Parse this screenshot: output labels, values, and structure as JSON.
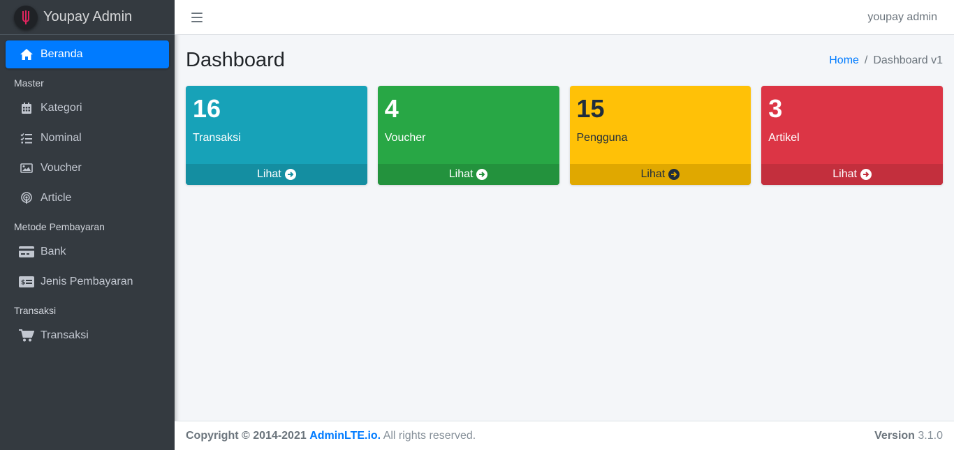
{
  "brand": {
    "name": "Youpay Admin"
  },
  "sidebar": {
    "items": [
      {
        "label": "Beranda",
        "icon": "home-icon"
      },
      {
        "header": "Master"
      },
      {
        "label": "Kategori",
        "icon": "calendar-icon"
      },
      {
        "label": "Nominal",
        "icon": "tasks-icon"
      },
      {
        "label": "Voucher",
        "icon": "image-icon"
      },
      {
        "label": "Article",
        "icon": "podcast-icon"
      },
      {
        "header": "Metode Pembayaran"
      },
      {
        "label": "Bank",
        "icon": "credit-card-icon"
      },
      {
        "label": "Jenis Pembayaran",
        "icon": "money-check-icon"
      },
      {
        "header": "Transaksi"
      },
      {
        "label": "Transaksi",
        "icon": "cart-icon"
      }
    ]
  },
  "topbar": {
    "user": "youpay admin"
  },
  "header": {
    "title": "Dashboard",
    "breadcrumb": [
      "Home",
      "Dashboard v1"
    ],
    "breadcrumb_sep": "/"
  },
  "boxes": [
    {
      "count": "16",
      "label": "Transaksi",
      "link": "Lihat",
      "color": "#17a2b8"
    },
    {
      "count": "4",
      "label": "Voucher",
      "link": "Lihat",
      "color": "#28a745"
    },
    {
      "count": "15",
      "label": "Pengguna",
      "link": "Lihat",
      "color": "#ffc107"
    },
    {
      "count": "3",
      "label": "Artikel",
      "link": "Lihat",
      "color": "#dc3545"
    }
  ],
  "footer": {
    "copyright": "Copyright © 2014-2021",
    "brand": "AdminLTE.io.",
    "rights": "All rights reserved.",
    "version_label": "Version",
    "version": "3.1.0"
  }
}
